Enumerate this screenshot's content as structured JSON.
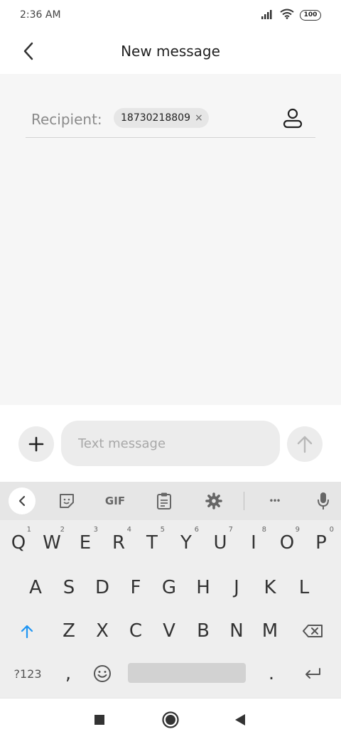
{
  "status_bar": {
    "time": "2:36 AM",
    "battery": "100"
  },
  "header": {
    "title": "New message"
  },
  "recipient": {
    "label": "Recipient:",
    "chip_number": "18730218809",
    "chip_remove": "×"
  },
  "composer": {
    "placeholder": "Text message"
  },
  "keyboard": {
    "toolbar": {
      "gif": "GIF",
      "more": "•••"
    },
    "row1": [
      {
        "key": "Q",
        "hint": "1"
      },
      {
        "key": "W",
        "hint": "2"
      },
      {
        "key": "E",
        "hint": "3"
      },
      {
        "key": "R",
        "hint": "4"
      },
      {
        "key": "T",
        "hint": "5"
      },
      {
        "key": "Y",
        "hint": "6"
      },
      {
        "key": "U",
        "hint": "7"
      },
      {
        "key": "I",
        "hint": "8"
      },
      {
        "key": "O",
        "hint": "9"
      },
      {
        "key": "P",
        "hint": "0"
      }
    ],
    "row2": [
      "A",
      "S",
      "D",
      "F",
      "G",
      "H",
      "J",
      "K",
      "L"
    ],
    "row3": [
      "Z",
      "X",
      "C",
      "V",
      "B",
      "N",
      "M"
    ],
    "row4": {
      "symbols": "?123",
      "comma": ",",
      "period": "."
    }
  },
  "colors": {
    "shift_key": "#2196f3",
    "background": "#f6f6f6"
  }
}
